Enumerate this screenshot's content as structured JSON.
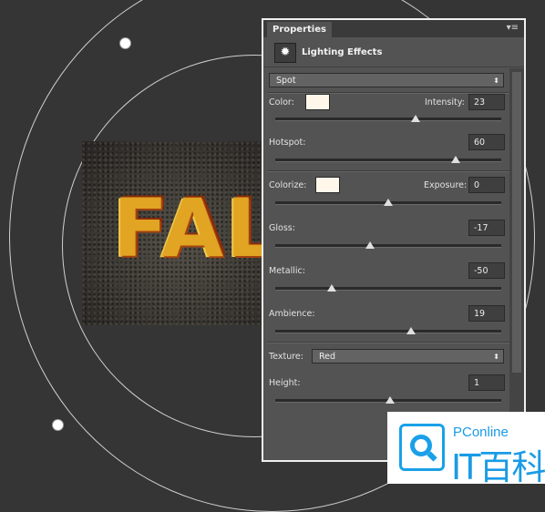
{
  "panel": {
    "tab_label": "Properties",
    "menu_glyph": "▾≡",
    "title": "Lighting Effects",
    "title_icon": "lightbulb-icon"
  },
  "light_type": {
    "value": "Spot"
  },
  "color": {
    "label": "Color:",
    "swatch_color": "#fff8ea"
  },
  "intensity": {
    "label": "Intensity:",
    "value": "23",
    "slider_fraction": 0.62
  },
  "hotspot": {
    "label": "Hotspot:",
    "value": "60",
    "slider_fraction": 0.8
  },
  "colorize": {
    "label": "Colorize:",
    "swatch_color": "#fff8ea"
  },
  "exposure": {
    "label": "Exposure:",
    "value": "0",
    "slider_fraction": 0.5
  },
  "gloss": {
    "label": "Gloss:",
    "value": "-17",
    "slider_fraction": 0.42
  },
  "metallic": {
    "label": "Metallic:",
    "value": "-50",
    "slider_fraction": 0.25
  },
  "ambience": {
    "label": "Ambience:",
    "value": "19",
    "slider_fraction": 0.6
  },
  "texture": {
    "label": "Texture:",
    "value": "Red"
  },
  "height": {
    "label": "Height:",
    "value": "1",
    "slider_fraction": 0.51
  },
  "canvas": {
    "photo_text": "FAL"
  },
  "watermark": {
    "brand": "PConline",
    "name": "IT百科",
    "accent": "#1a9be6"
  }
}
